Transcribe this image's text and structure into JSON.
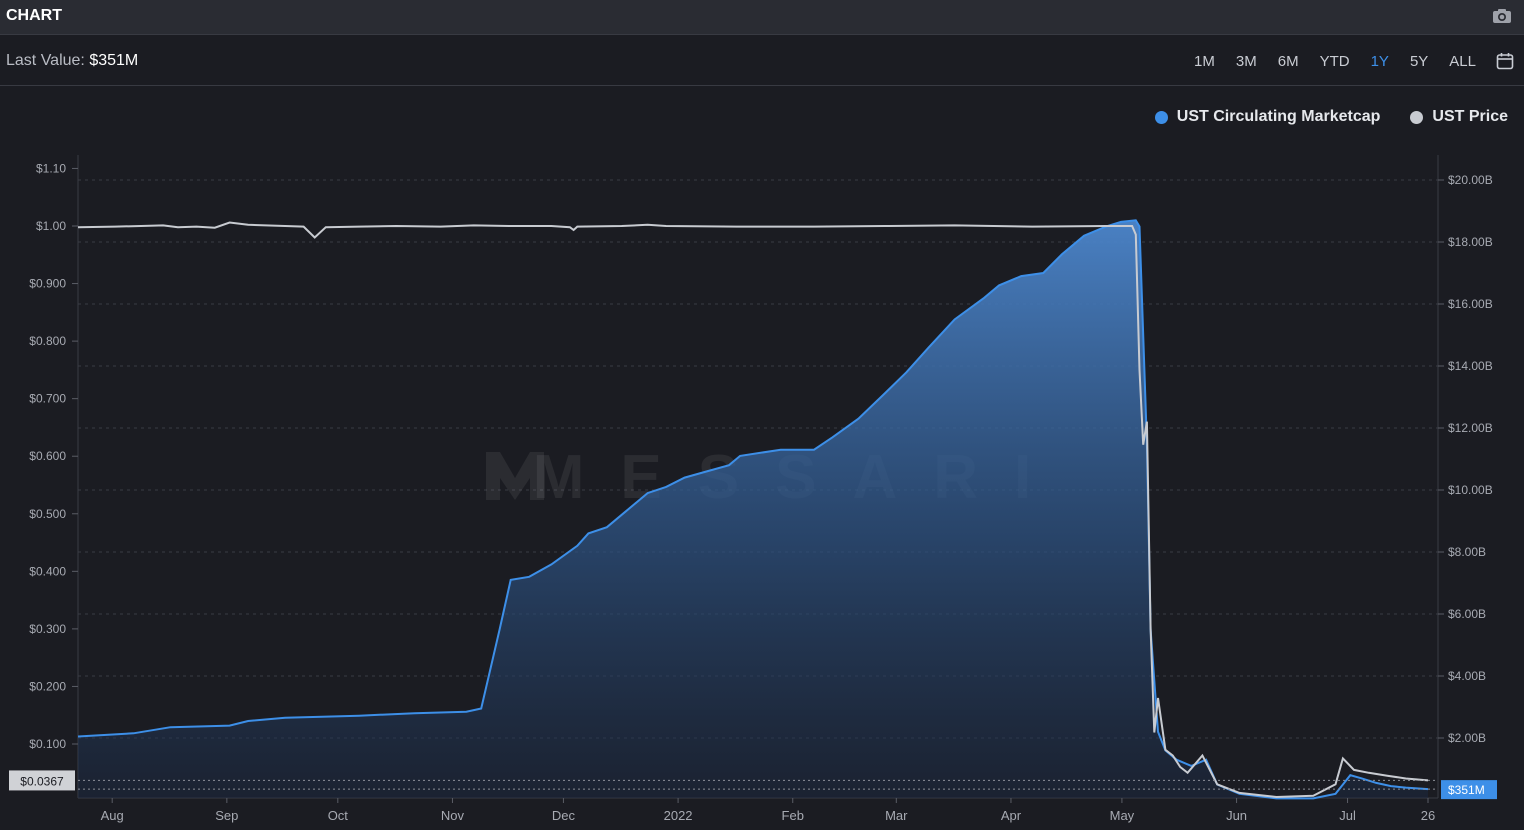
{
  "header": {
    "title": "CHART",
    "camera_icon": "camera-icon"
  },
  "summary": {
    "last_value_label": "Last Value:",
    "last_value": "$351M"
  },
  "ranges": {
    "items": [
      "1M",
      "3M",
      "6M",
      "YTD",
      "1Y",
      "5Y",
      "ALL"
    ],
    "active": "1Y",
    "calendar_icon": "calendar-icon"
  },
  "colors": {
    "marketcap": "#3d8fe8",
    "price": "#c8cbd1",
    "background": "#1b1c22",
    "grid": "#3a3c44"
  },
  "watermark": "MESSARI",
  "chart_data": {
    "type": "area",
    "x_tick_labels": [
      "Aug",
      "Sep",
      "Oct",
      "Nov",
      "Dec",
      "2022",
      "Feb",
      "Mar",
      "Apr",
      "May",
      "Jun",
      "Jul",
      "26"
    ],
    "x_range": [
      "2021-07-26",
      "2022-07-26"
    ],
    "y_left": {
      "ticks": [
        0.1,
        0.2,
        0.3,
        0.4,
        0.5,
        0.6,
        0.7,
        0.8,
        0.9,
        1.0,
        1.1
      ],
      "tick_labels": [
        "$0.100",
        "$0.200",
        "$0.300",
        "$0.400",
        "$0.500",
        "$0.600",
        "$0.700",
        "$0.800",
        "$0.900",
        "$1.00",
        "$1.10"
      ],
      "range": [
        0,
        1.1
      ],
      "current_label": "$0.0367"
    },
    "y_right": {
      "ticks": [
        2,
        4,
        6,
        8,
        10,
        12,
        14,
        16,
        18,
        20
      ],
      "tick_labels": [
        "$2.00B",
        "$4.00B",
        "$6.00B",
        "$8.00B",
        "$10.00B",
        "$12.00B",
        "$14.00B",
        "$16.00B",
        "$18.00B",
        "$20.00B",
        "$351M"
      ],
      "range": [
        0,
        20
      ],
      "current_label": "$351M"
    },
    "legend_position": "top-right",
    "series": [
      {
        "name": "UST Circulating Marketcap",
        "axis": "right",
        "unit": "$B",
        "points": [
          [
            "2021-07-26",
            2.05
          ],
          [
            "2021-08-10",
            2.15
          ],
          [
            "2021-08-20",
            2.35
          ],
          [
            "2021-09-05",
            2.4
          ],
          [
            "2021-09-10",
            2.55
          ],
          [
            "2021-09-20",
            2.65
          ],
          [
            "2021-10-10",
            2.72
          ],
          [
            "2021-10-25",
            2.8
          ],
          [
            "2021-11-08",
            2.85
          ],
          [
            "2021-11-12",
            2.95
          ],
          [
            "2021-11-17",
            5.5
          ],
          [
            "2021-11-20",
            7.1
          ],
          [
            "2021-11-25",
            7.2
          ],
          [
            "2021-12-01",
            7.6
          ],
          [
            "2021-12-08",
            8.2
          ],
          [
            "2021-12-11",
            8.6
          ],
          [
            "2021-12-16",
            8.8
          ],
          [
            "2021-12-21",
            9.3
          ],
          [
            "2021-12-27",
            9.9
          ],
          [
            "2022-01-01",
            10.1
          ],
          [
            "2022-01-06",
            10.4
          ],
          [
            "2022-01-12",
            10.6
          ],
          [
            "2022-01-18",
            10.8
          ],
          [
            "2022-01-21",
            11.1
          ],
          [
            "2022-02-01",
            11.3
          ],
          [
            "2022-02-10",
            11.3
          ],
          [
            "2022-02-15",
            11.7
          ],
          [
            "2022-02-22",
            12.3
          ],
          [
            "2022-03-01",
            13.1
          ],
          [
            "2022-03-07",
            13.8
          ],
          [
            "2022-03-13",
            14.6
          ],
          [
            "2022-03-20",
            15.5
          ],
          [
            "2022-03-28",
            16.2
          ],
          [
            "2022-04-01",
            16.6
          ],
          [
            "2022-04-07",
            16.9
          ],
          [
            "2022-04-13",
            17.0
          ],
          [
            "2022-04-18",
            17.6
          ],
          [
            "2022-04-24",
            18.2
          ],
          [
            "2022-04-30",
            18.5
          ],
          [
            "2022-05-04",
            18.65
          ],
          [
            "2022-05-08",
            18.7
          ],
          [
            "2022-05-09",
            18.5
          ],
          [
            "2022-05-11",
            11.5
          ],
          [
            "2022-05-12",
            5.5
          ],
          [
            "2022-05-14",
            2.2
          ],
          [
            "2022-05-16",
            1.6
          ],
          [
            "2022-05-19",
            1.3
          ],
          [
            "2022-05-23",
            1.1
          ],
          [
            "2022-05-27",
            1.3
          ],
          [
            "2022-05-30",
            0.5
          ],
          [
            "2022-06-05",
            0.2
          ],
          [
            "2022-06-15",
            0.05
          ],
          [
            "2022-06-25",
            0.05
          ],
          [
            "2022-07-01",
            0.2
          ],
          [
            "2022-07-03",
            0.5
          ],
          [
            "2022-07-05",
            0.8
          ],
          [
            "2022-07-08",
            0.7
          ],
          [
            "2022-07-12",
            0.55
          ],
          [
            "2022-07-16",
            0.45
          ],
          [
            "2022-07-20",
            0.4
          ],
          [
            "2022-07-26",
            0.351
          ]
        ]
      },
      {
        "name": "UST Price",
        "axis": "left",
        "unit": "$",
        "points": [
          [
            "2021-07-26",
            0.998
          ],
          [
            "2021-08-05",
            0.999
          ],
          [
            "2021-08-12",
            1.0
          ],
          [
            "2021-08-18",
            1.001
          ],
          [
            "2021-08-22",
            0.998
          ],
          [
            "2021-08-27",
            0.999
          ],
          [
            "2021-09-01",
            0.997
          ],
          [
            "2021-09-05",
            1.006
          ],
          [
            "2021-09-10",
            1.002
          ],
          [
            "2021-09-20",
            1.0
          ],
          [
            "2021-09-25",
            0.999
          ],
          [
            "2021-09-28",
            0.98
          ],
          [
            "2021-10-01",
            0.998
          ],
          [
            "2021-10-10",
            0.999
          ],
          [
            "2021-10-20",
            1.0
          ],
          [
            "2021-11-01",
            0.999
          ],
          [
            "2021-11-10",
            1.001
          ],
          [
            "2021-11-20",
            1.0
          ],
          [
            "2021-12-01",
            1.0
          ],
          [
            "2021-12-06",
            0.998
          ],
          [
            "2021-12-07",
            0.993
          ],
          [
            "2021-12-08",
            0.999
          ],
          [
            "2021-12-20",
            1.0
          ],
          [
            "2021-12-27",
            1.002
          ],
          [
            "2022-01-01",
            1.0
          ],
          [
            "2022-01-20",
            0.999
          ],
          [
            "2022-02-10",
            0.999
          ],
          [
            "2022-03-01",
            1.0
          ],
          [
            "2022-03-20",
            1.001
          ],
          [
            "2022-04-10",
            0.999
          ],
          [
            "2022-04-30",
            1.0
          ],
          [
            "2022-05-07",
            1.0
          ],
          [
            "2022-05-08",
            0.985
          ],
          [
            "2022-05-09",
            0.75
          ],
          [
            "2022-05-10",
            0.62
          ],
          [
            "2022-05-11",
            0.66
          ],
          [
            "2022-05-12",
            0.3
          ],
          [
            "2022-05-13",
            0.12
          ],
          [
            "2022-05-14",
            0.18
          ],
          [
            "2022-05-16",
            0.09
          ],
          [
            "2022-05-18",
            0.08
          ],
          [
            "2022-05-20",
            0.06
          ],
          [
            "2022-05-22",
            0.05
          ],
          [
            "2022-05-26",
            0.08
          ],
          [
            "2022-05-30",
            0.03
          ],
          [
            "2022-06-05",
            0.015
          ],
          [
            "2022-06-15",
            0.008
          ],
          [
            "2022-06-25",
            0.01
          ],
          [
            "2022-07-01",
            0.03
          ],
          [
            "2022-07-03",
            0.075
          ],
          [
            "2022-07-06",
            0.055
          ],
          [
            "2022-07-10",
            0.05
          ],
          [
            "2022-07-15",
            0.045
          ],
          [
            "2022-07-20",
            0.04
          ],
          [
            "2022-07-26",
            0.0367
          ]
        ]
      }
    ]
  }
}
